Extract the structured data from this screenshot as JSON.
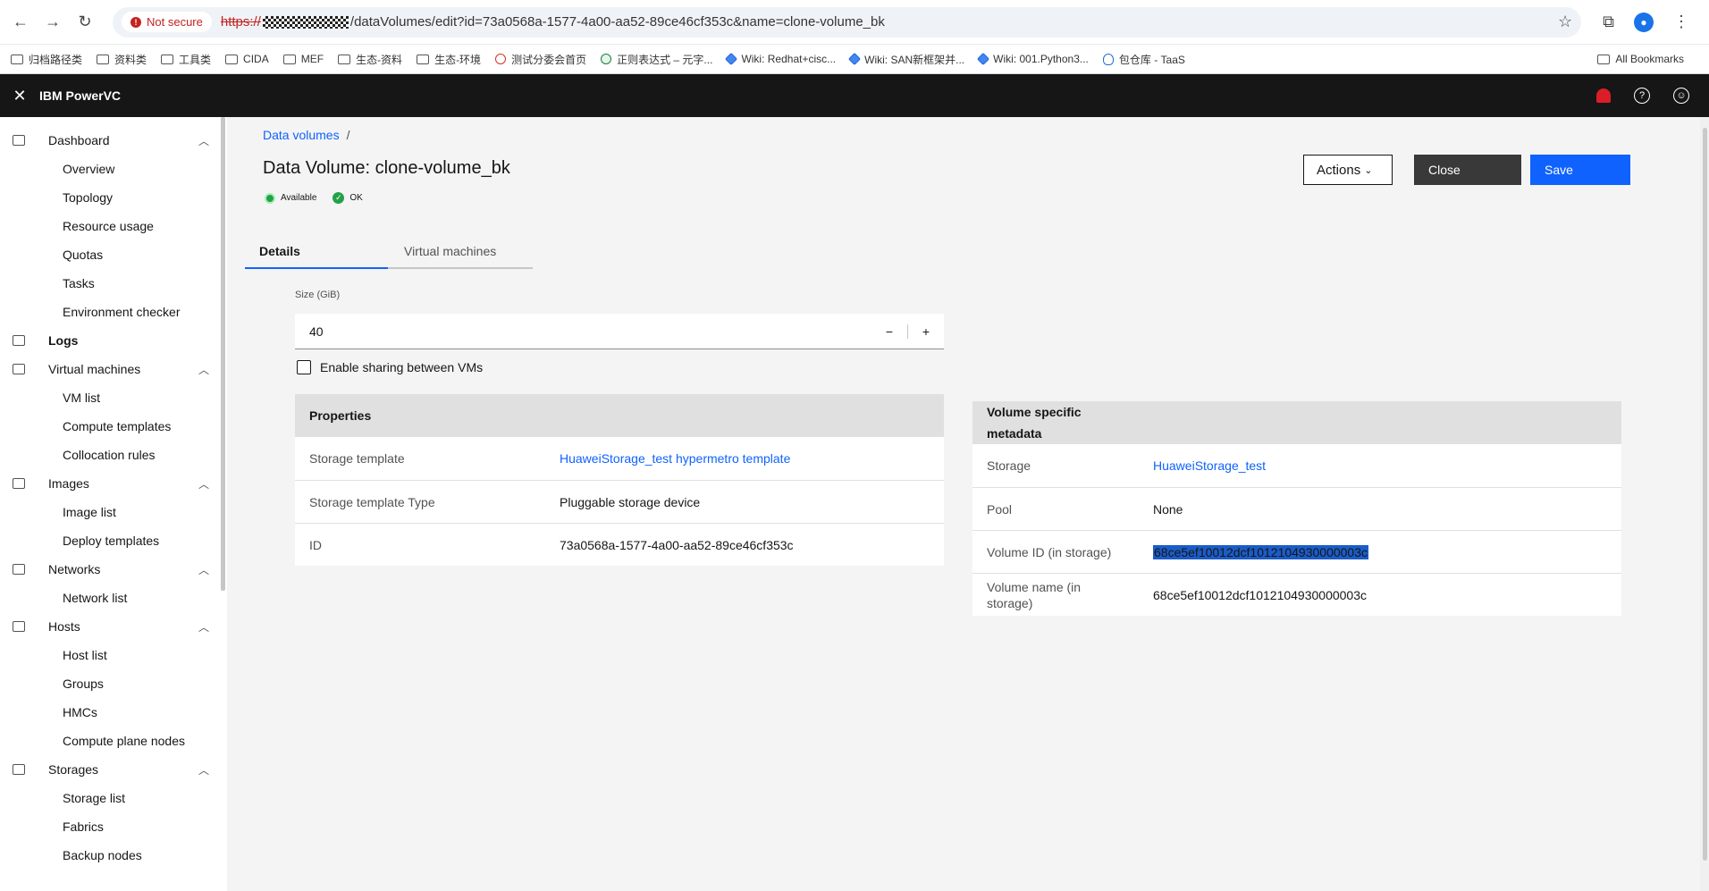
{
  "browser": {
    "security_label": "Not secure",
    "url_scheme": "https://",
    "url_path": "/dataVolumes/edit?id=73a0568a-1577-4a00-aa52-89ce46cf353c&name=clone-volume_bk",
    "bookmarks": [
      "归档路径类",
      "资料类",
      "工具类",
      "CIDA",
      "MEF",
      "生态-资料",
      "生态-环境",
      "测试分委会首页",
      "正则表达式 – 元字...",
      "Wiki: Redhat+cisc...",
      "Wiki: SAN新框架并...",
      "Wiki: 001.Python3...",
      "包仓库 - TaaS"
    ],
    "all_bookmarks": "All Bookmarks"
  },
  "app": {
    "title": "IBM PowerVC"
  },
  "sidebar": {
    "dashboard": "Dashboard",
    "dashboard_items": [
      "Overview",
      "Topology",
      "Resource usage",
      "Quotas",
      "Tasks",
      "Environment checker"
    ],
    "logs": "Logs",
    "virtual_machines": "Virtual machines",
    "vm_items": [
      "VM list",
      "Compute templates",
      "Collocation rules"
    ],
    "images": "Images",
    "image_items": [
      "Image list",
      "Deploy templates"
    ],
    "networks": "Networks",
    "network_items": [
      "Network list"
    ],
    "hosts": "Hosts",
    "host_items": [
      "Host list",
      "Groups",
      "HMCs",
      "Compute plane nodes"
    ],
    "storages": "Storages",
    "storage_items": [
      "Storage list",
      "Fabrics",
      "Backup nodes"
    ]
  },
  "main": {
    "breadcrumb": "Data volumes",
    "breadcrumb_sep": "/",
    "title": "Data Volume: clone-volume_bk",
    "status_available": "Available",
    "status_ok": "OK",
    "actions_label": "Actions",
    "close_label": "Close",
    "save_label": "Save",
    "tabs": [
      "Details",
      "Virtual machines"
    ],
    "size_label": "Size (GiB)",
    "size_value": "40",
    "sharing_label": "Enable sharing between VMs"
  },
  "properties": {
    "heading": "Properties",
    "rows": [
      {
        "key": "Storage template",
        "value": "HuaweiStorage_test hypermetro template"
      },
      {
        "key": "Storage template Type",
        "value": "Pluggable storage device"
      },
      {
        "key": "ID",
        "value": "73a0568a-1577-4a00-aa52-89ce46cf353c"
      }
    ]
  },
  "metadata": {
    "heading_line1": "Volume specific",
    "heading_line2": "metadata",
    "rows": [
      {
        "key": "Storage",
        "value": "HuaweiStorage_test"
      },
      {
        "key": "Pool",
        "value": "None"
      },
      {
        "key": "Volume ID (in storage)",
        "value": "68ce5ef10012dcf1012104930000003c"
      },
      {
        "key_line1": "Volume name (in",
        "key_line2": "storage)",
        "value": "68ce5ef10012dcf1012104930000003c"
      }
    ]
  },
  "colors": {
    "primary": "#0f62fe",
    "header_bg": "#161616",
    "alert": "#da1e28",
    "success": "#24a148"
  }
}
